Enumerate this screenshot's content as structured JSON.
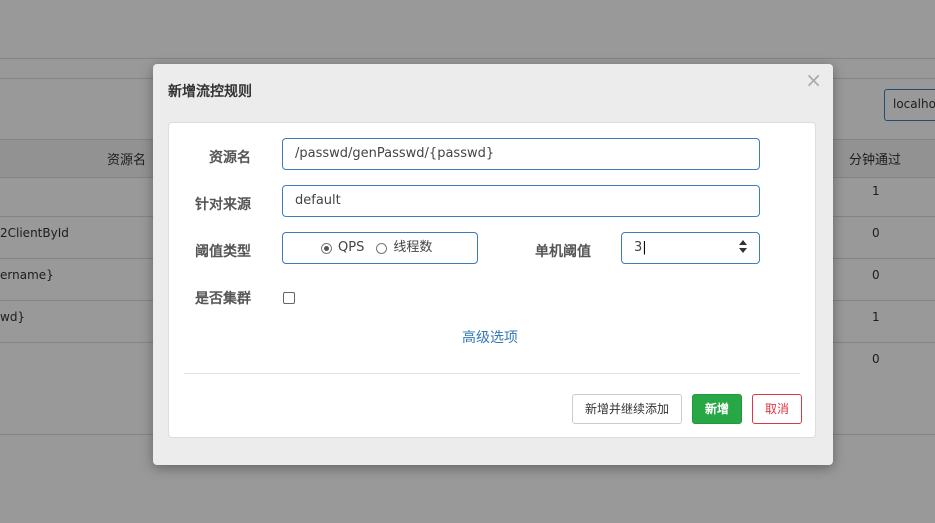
{
  "background": {
    "table_header": {
      "resource_col": "资源名",
      "pass_col": "分钟通过"
    },
    "search_input_value": "localho",
    "rows": [
      {
        "resource": "",
        "pass": "1"
      },
      {
        "resource": "2ClientById",
        "pass": "0"
      },
      {
        "resource": "ername}",
        "pass": "0"
      },
      {
        "resource": "wd}",
        "pass": "1"
      },
      {
        "resource": "",
        "pass": "0"
      }
    ]
  },
  "modal": {
    "title": "新增流控规则",
    "close_icon": "close-icon",
    "fields": {
      "resource_label": "资源名",
      "resource_value": "/passwd/genPasswd/{passwd}",
      "origin_label": "针对来源",
      "origin_value": "default",
      "threshold_type_label": "阈值类型",
      "threshold_options": [
        {
          "label": "QPS",
          "checked": true
        },
        {
          "label": "线程数",
          "checked": false
        }
      ],
      "single_threshold_label": "单机阈值",
      "single_threshold_value": "3",
      "cluster_label": "是否集群",
      "cluster_checked": false
    },
    "advanced_link": "高级选项",
    "buttons": {
      "add_continue": "新增并继续添加",
      "add": "新增",
      "cancel": "取消"
    }
  },
  "colors": {
    "accent": "#3c7dbf",
    "success": "#28a745",
    "danger": "#dc3545",
    "link": "#337ab7"
  }
}
